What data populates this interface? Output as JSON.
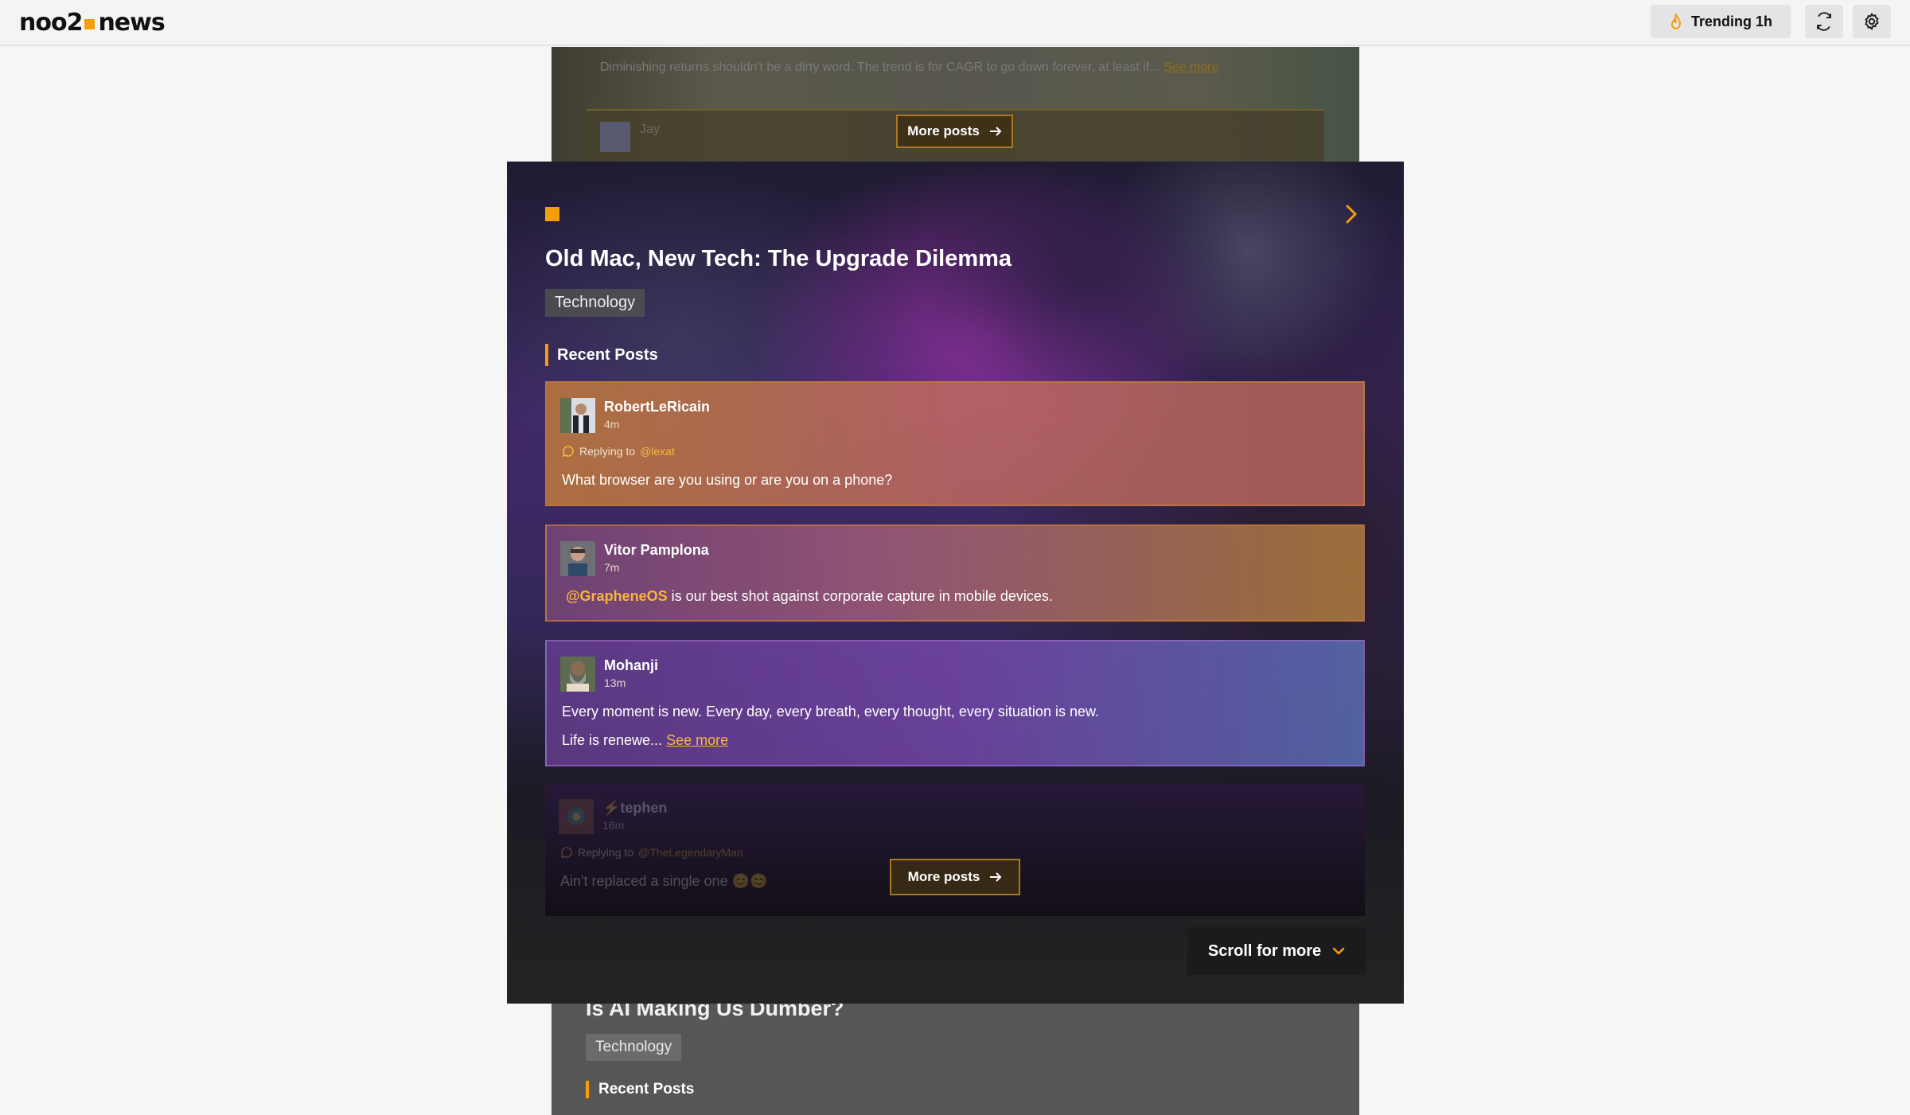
{
  "header": {
    "logo_left": "noo2",
    "logo_right": "news",
    "trending_label": "Trending 1h",
    "accent": "#f59e0b"
  },
  "background_top": {
    "snippet": "Diminishing returns shouldn't be a dirty word. The trend is for CAGR to go down forever, at least if...",
    "see_more": "See more",
    "author": "Jay",
    "more_posts": "More posts"
  },
  "main_card": {
    "title": "Old Mac, New Tech: The Upgrade Dilemma",
    "category": "Technology",
    "recent_label": "Recent Posts",
    "posts": [
      {
        "author": "RobertLeRicain",
        "time": "4m",
        "reply_prefix": "Replying to",
        "reply_to": "@lexat",
        "text": "What browser are you using or are you on a phone?"
      },
      {
        "author": "Vitor Pamplona",
        "time": "7m",
        "mention": "@GrapheneOS",
        "text": "is our best shot against corporate capture in mobile devices."
      },
      {
        "author": "Mohanji",
        "time": "13m",
        "text": "Every moment is new. Every day, every breath, every thought, every situation is new.",
        "text2": "Life is renewe...",
        "see_more": "See more"
      },
      {
        "author": "⚡tephen",
        "time": "16m",
        "reply_prefix": "Replying to",
        "reply_to": "@TheLegendaryMan",
        "text": "Ain't replaced a single one 😊😊"
      }
    ],
    "more_posts": "More posts",
    "scroll_label": "Scroll for more"
  },
  "background_bottom": {
    "title": "Is AI Making Us Dumber?",
    "category": "Technology",
    "recent_label": "Recent Posts"
  }
}
